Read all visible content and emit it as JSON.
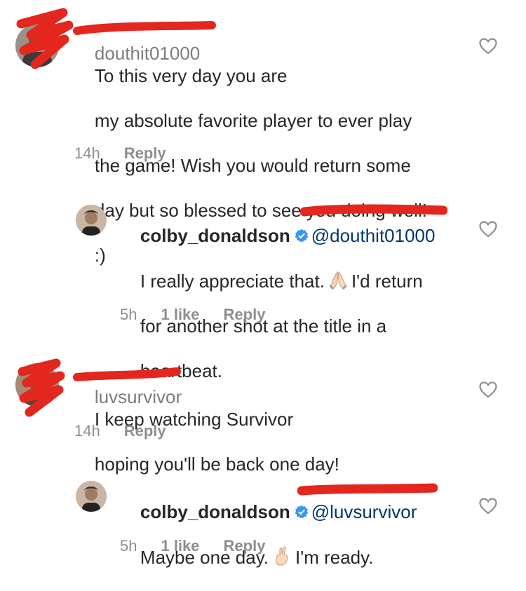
{
  "comments": [
    {
      "username": "douthit01000",
      "text_lines": [
        "To this very day you are",
        "my absolute favorite player to ever play",
        "the game! Wish you would return some",
        "day but so blessed to see you doing well!",
        ":)"
      ],
      "time": "14h",
      "reply_label": "Reply",
      "like_icon": "heart-outline-icon"
    },
    {
      "username": "colby_donaldson",
      "verified": true,
      "mention": "@douthit01000",
      "text_part1": "I really appreciate that.",
      "emoji1": "folded-hands-emoji",
      "text_part2": "I'd return",
      "text_line2": "for another shot at the title in a",
      "text_line3": "heartbeat.",
      "time": "5h",
      "likes": "1 like",
      "reply_label": "Reply",
      "like_icon": "heart-outline-icon"
    },
    {
      "username": "luvsurvivor",
      "text_line1": "I keep watching Survivor",
      "text_line2": "hoping you'll be back one day!",
      "time": "14h",
      "reply_label": "Reply",
      "like_icon": "heart-outline-icon"
    },
    {
      "username": "colby_donaldson",
      "verified": true,
      "mention": "@luvsurvivor",
      "text_part1": "Maybe one day.",
      "emoji1": "crossed-fingers-emoji",
      "text_part2": "I'm ready.",
      "time": "5h",
      "likes": "1 like",
      "reply_label": "Reply",
      "like_icon": "heart-outline-icon"
    }
  ],
  "colors": {
    "text": "#262626",
    "meta": "#8e8e8e",
    "mention": "#00376b",
    "verified": "#3897f0",
    "redaction": "#e3261e"
  }
}
